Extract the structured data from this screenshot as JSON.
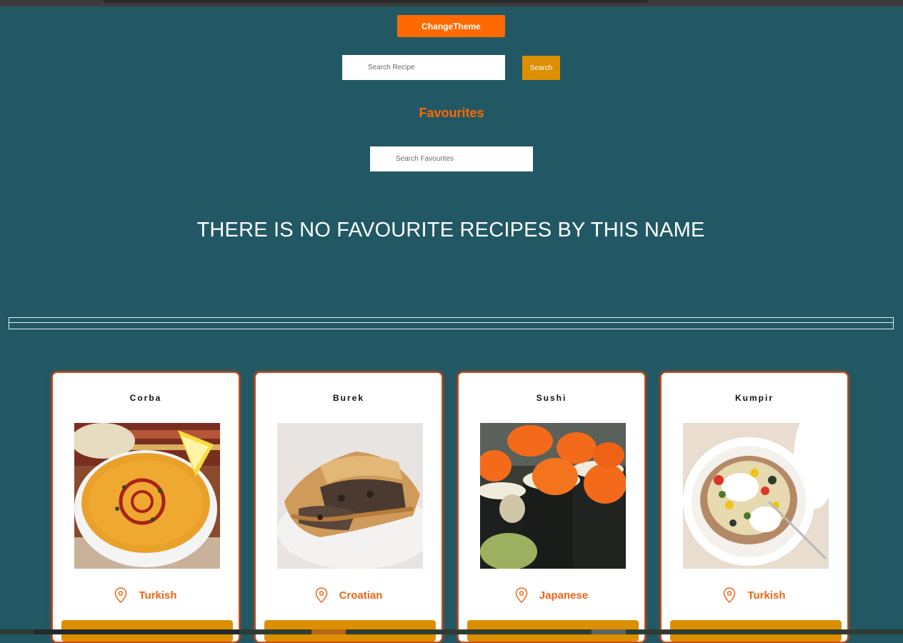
{
  "header": {
    "change_theme_label": "ChangeTheme"
  },
  "search": {
    "placeholder": "Search Recipe",
    "button_label": "Search"
  },
  "favourites": {
    "title": "Favourites",
    "search_placeholder": "Search Favourites",
    "empty_message": "THERE IS NO FAVOURITE RECIPES BY THIS NAME"
  },
  "recipes": [
    {
      "name": "Corba",
      "origin": "Turkish",
      "image": "lentil-soup"
    },
    {
      "name": "Burek",
      "origin": "Croatian",
      "image": "meat-pastry"
    },
    {
      "name": "Sushi",
      "origin": "Japanese",
      "image": "sushi-rolls"
    },
    {
      "name": "Kumpir",
      "origin": "Turkish",
      "image": "stuffed-potato"
    }
  ],
  "colors": {
    "background": "#215864",
    "accent": "#ff6a00",
    "button": "#dc8f00",
    "card_border": "#cf4a16"
  }
}
